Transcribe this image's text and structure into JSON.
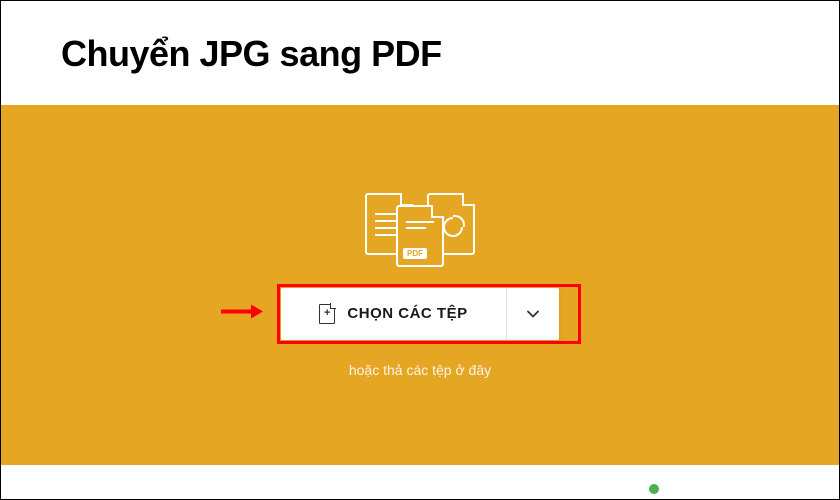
{
  "header": {
    "title": "Chuyển JPG sang PDF"
  },
  "upload": {
    "pdf_badge": "PDF",
    "choose_button_label": "CHỌN CÁC TỆP",
    "drop_hint": "hoặc thả các tệp ở đây"
  }
}
